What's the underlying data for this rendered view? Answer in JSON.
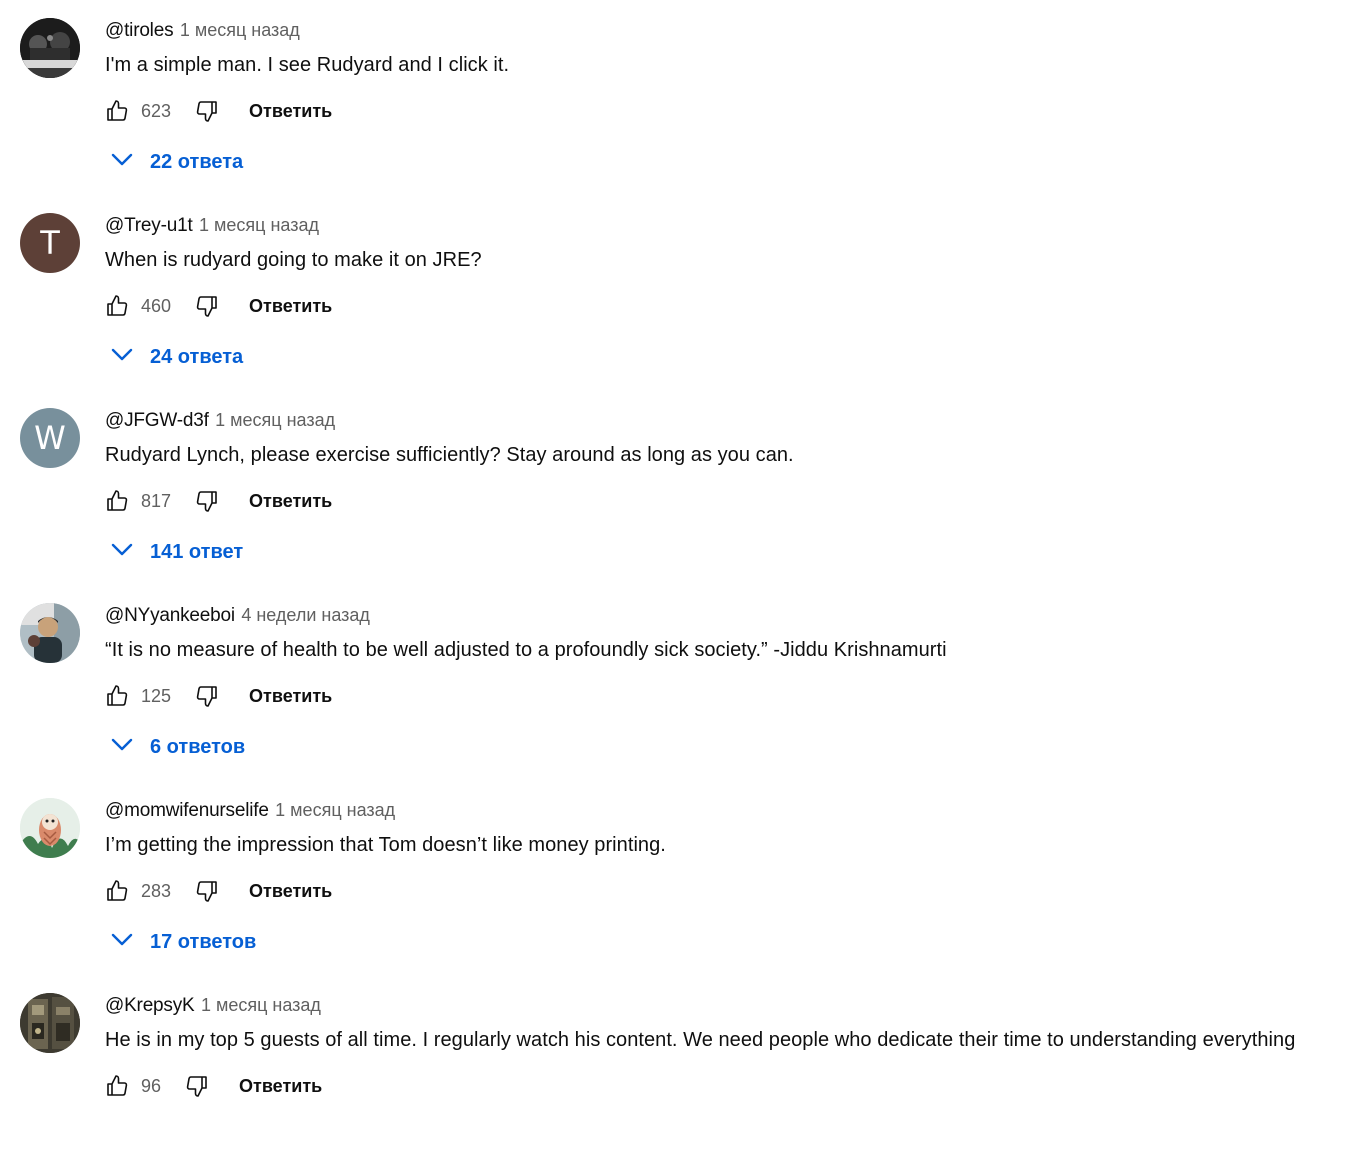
{
  "reply_label": "Ответить",
  "icons": {
    "like": "thumb-up-icon",
    "dislike": "thumb-down-icon",
    "expand": "chevron-down-icon"
  },
  "colors": {
    "author": "#0f0f0f",
    "meta": "#606060",
    "link": "#065fd4",
    "avatar_trey": "#5d4037",
    "avatar_jfgw": "#78909c"
  },
  "comments": [
    {
      "author": "@tiroles",
      "time": "1 месяц назад",
      "text": "I'm a simple man. I see Rudyard and I click it.",
      "likes": "623",
      "replies": "22 ответа",
      "avatar_type": "photo"
    },
    {
      "author": "@Trey-u1t",
      "time": "1 месяц назад",
      "text": "When is rudyard going to make it on JRE?",
      "likes": "460",
      "replies": "24 ответа",
      "avatar_type": "letter",
      "avatar_letter": "T"
    },
    {
      "author": "@JFGW-d3f",
      "time": "1 месяц назад",
      "text": "Rudyard Lynch, please exercise sufficiently? Stay around as long as you can.",
      "likes": "817",
      "replies": "141 ответ",
      "avatar_type": "letter",
      "avatar_letter": "W"
    },
    {
      "author": "@NYyankeeboi",
      "time": "4 недели назад",
      "text": "“It is no measure of health to be well adjusted to a profoundly sick society.” -Jiddu Krishnamurti",
      "likes": "125",
      "replies": "6 ответов",
      "avatar_type": "photo"
    },
    {
      "author": "@momwifenurselife",
      "time": "1 месяц назад",
      "text": "I’m getting the impression that Tom doesn’t like money printing.",
      "likes": "283",
      "replies": "17 ответов",
      "avatar_type": "illustration"
    },
    {
      "author": "@KrepsyK",
      "time": "1 месяц назад",
      "text": "He is in my top 5 guests of all time. I regularly watch his content. We need people who dedicate their time to understanding everything",
      "likes": "96",
      "avatar_type": "photo"
    }
  ]
}
